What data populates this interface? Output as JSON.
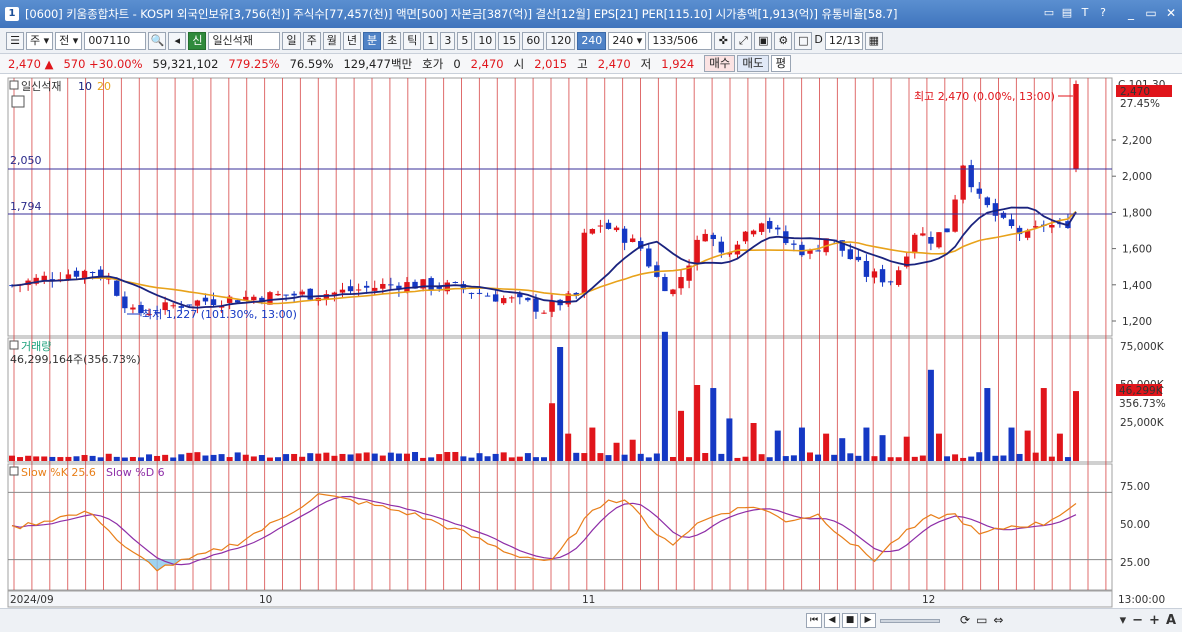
{
  "titlebar": {
    "window_number": "1",
    "title": "[0600] 키움종합차트 - KOSPI 외국인보유[3,756(천)] 주식수[77,457(천)] 액면[500] 자본금[387(억)] 결산[12월] EPS[21] PER[115.10] 시가총액[1,913(억)] 유통비율[58.7]",
    "icons": [
      "restore-icon",
      "print-icon",
      "text-icon",
      "help-icon"
    ],
    "icon_glyphs": [
      "▭",
      "▤",
      "T",
      "?"
    ],
    "window_controls": [
      "_",
      "▭",
      "✕"
    ]
  },
  "toolbar": {
    "market": "주",
    "view": "전",
    "code": "007110",
    "stock_badge": "신",
    "stock_name": "일신석재",
    "periods": [
      "일",
      "주",
      "월",
      "년",
      "분",
      "초",
      "틱"
    ],
    "selected_period": "분",
    "intervals": [
      "1",
      "3",
      "5",
      "10",
      "15",
      "60",
      "120",
      "240"
    ],
    "selected_interval": "240",
    "interval_value": "240",
    "count": "133",
    "count_total": "/506",
    "date": "12/13",
    "d_label": "D"
  },
  "quote": {
    "price": "2,470",
    "change": "570",
    "change_pct": "+30.00%",
    "volume": "59,321,102",
    "volume_ratio": "779.25%",
    "turnover": "76.59%",
    "amount": "129,477백만",
    "hoga_label": "호가",
    "hoga_value": "0",
    "current": "2,470",
    "open_label": "시",
    "open": "2,015",
    "high_label": "고",
    "high": "2,470",
    "low_label": "저",
    "low": "1,924",
    "buy_label": "매수",
    "sell_label": "매도",
    "eval_label": "평"
  },
  "chart": {
    "price_legend_name": "일신석재",
    "ma_short": "10",
    "ma_long": "20",
    "high_annotation": "최고 2,470 (0.00%, 13:00)",
    "low_annotation": "최저 1,227 (101.30%, 13:00)",
    "hline_upper": "2,050",
    "hline_lower": "1,794",
    "last_price_box": "2,470",
    "last_price_pct": "27.45%",
    "top_axis_label": "C 101.30",
    "price_ticks": [
      "2,200",
      "2,000",
      "1,800",
      "1,600",
      "1,400",
      "1,200"
    ],
    "volume_legend": "거래량",
    "volume_value": "46,299,164주(356.73%)",
    "volume_box": "46,299K",
    "volume_box_pct": "356.73%",
    "volume_ticks": [
      "75,000K",
      "50,000K",
      "25,000K"
    ],
    "stoch_legend_k": "Slow %K 25.6",
    "stoch_legend_d": "Slow %D 6",
    "stoch_ticks": [
      "75.00",
      "50.00",
      "25.00"
    ],
    "date_labels": [
      "2024/09",
      "10",
      "11",
      "12"
    ],
    "time_label": "13:00:00"
  },
  "colors": {
    "up": "#e0151b",
    "down": "#1538c4",
    "ma10": "#1a237e",
    "ma20": "#e8a21a",
    "grid_red": "#d43b3b",
    "stoch_k": "#e87f1a",
    "stoch_d": "#8e2fa8"
  }
}
